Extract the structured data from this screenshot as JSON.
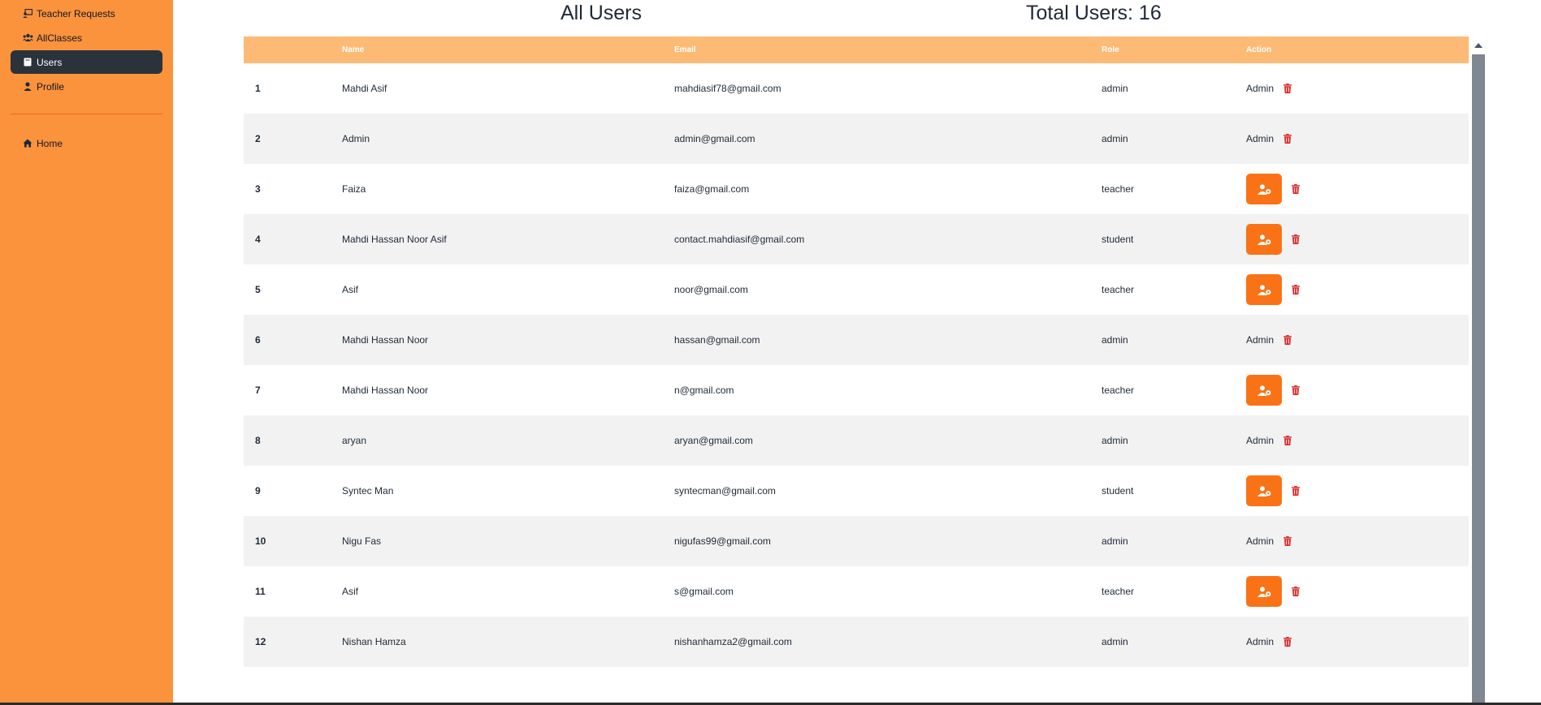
{
  "sidebar": {
    "items": [
      {
        "label": "Teacher Requests",
        "icon": "teacher-requests-icon",
        "active": false
      },
      {
        "label": "AllClasses",
        "icon": "users-group-icon",
        "active": false
      },
      {
        "label": "Users",
        "icon": "book-icon",
        "active": true
      },
      {
        "label": "Profile",
        "icon": "user-icon",
        "active": false
      }
    ],
    "home": {
      "label": "Home",
      "icon": "home-icon"
    }
  },
  "header": {
    "title": "All Users",
    "total": "Total Users: 16"
  },
  "table": {
    "columns": [
      "",
      "Name",
      "Email",
      "Role",
      "Action"
    ],
    "rows": [
      {
        "num": "1",
        "name": "Mahdi Asif",
        "email": "mahdiasif78@gmail.com",
        "role": "admin",
        "action": "Admin"
      },
      {
        "num": "2",
        "name": "Admin",
        "email": "admin@gmail.com",
        "role": "admin",
        "action": "Admin"
      },
      {
        "num": "3",
        "name": "Faiza",
        "email": "faiza@gmail.com",
        "role": "teacher",
        "action": "make-admin"
      },
      {
        "num": "4",
        "name": "Mahdi Hassan Noor Asif",
        "email": "contact.mahdiasif@gmail.com",
        "role": "student",
        "action": "make-admin"
      },
      {
        "num": "5",
        "name": "Asif",
        "email": "noor@gmail.com",
        "role": "teacher",
        "action": "make-admin"
      },
      {
        "num": "6",
        "name": "Mahdi Hassan Noor",
        "email": "hassan@gmail.com",
        "role": "admin",
        "action": "Admin"
      },
      {
        "num": "7",
        "name": "Mahdi Hassan Noor",
        "email": "n@gmail.com",
        "role": "teacher",
        "action": "make-admin"
      },
      {
        "num": "8",
        "name": "aryan",
        "email": "aryan@gmail.com",
        "role": "admin",
        "action": "Admin"
      },
      {
        "num": "9",
        "name": "Syntec Man",
        "email": "syntecman@gmail.com",
        "role": "student",
        "action": "make-admin"
      },
      {
        "num": "10",
        "name": "Nigu Fas",
        "email": "nigufas99@gmail.com",
        "role": "admin",
        "action": "Admin"
      },
      {
        "num": "11",
        "name": "Asif",
        "email": "s@gmail.com",
        "role": "teacher",
        "action": "make-admin"
      },
      {
        "num": "12",
        "name": "Nishan Hamza",
        "email": "nishanhamza2@gmail.com",
        "role": "admin",
        "action": "Admin"
      }
    ]
  },
  "colors": {
    "sidebar": "#fb923c",
    "active_item": "#2a323c",
    "table_header": "#fdba74",
    "action_button": "#f97316",
    "delete_icon": "#dc2626"
  }
}
